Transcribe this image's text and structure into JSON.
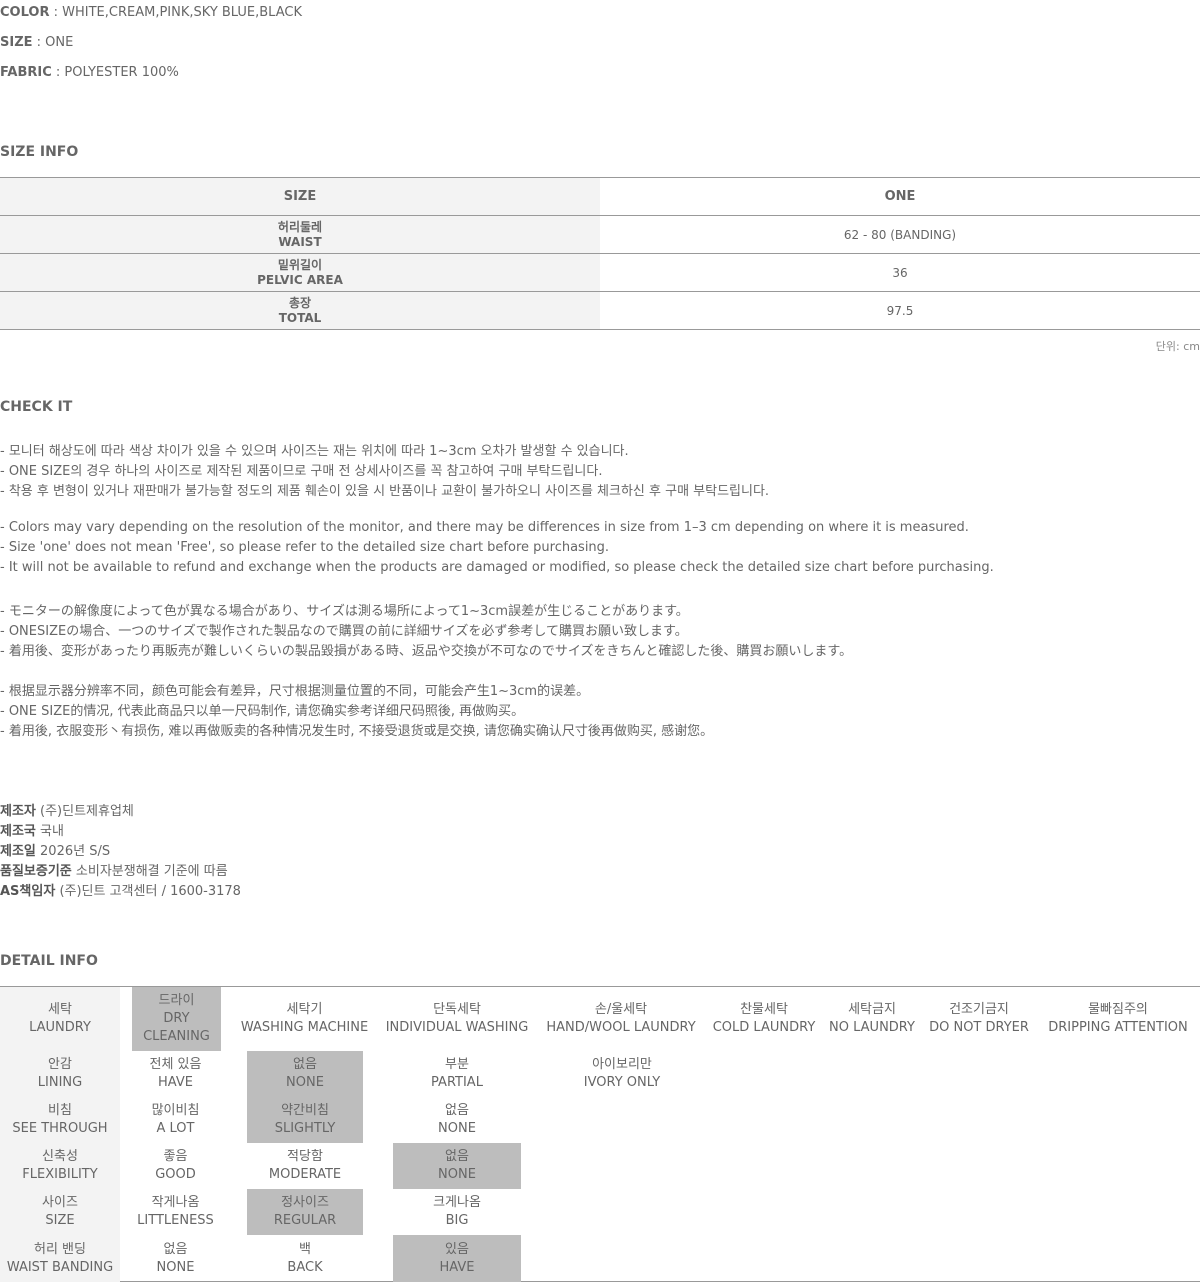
{
  "specs": [
    {
      "label": "COLOR",
      "value": " : WHITE,CREAM,PINK,SKY BLUE,BLACK"
    },
    {
      "label": "SIZE",
      "value": " : ONE"
    },
    {
      "label": "FABRIC",
      "value": " : POLYESTER 100%"
    }
  ],
  "size_info": {
    "title": "SIZE INFO",
    "header": {
      "label": "SIZE",
      "value": "ONE"
    },
    "rows": [
      {
        "ko": "허리둘레",
        "en": "WAIST",
        "value": "62 - 80 (BANDING)"
      },
      {
        "ko": "밑위길이",
        "en": "PELVIC AREA",
        "value": "36"
      },
      {
        "ko": "총장",
        "en": "TOTAL",
        "value": "97.5"
      }
    ],
    "unit": "단위: cm"
  },
  "check_it": {
    "title": "CHECK IT",
    "lines": [
      "- 모니터 해상도에 따라 색상 차이가 있을 수 있으며 사이즈는 재는 위치에 따라 1~3cm 오차가 발생할 수 있습니다.",
      "- ONE SIZE의 경우 하나의 사이즈로 제작된 제품이므로 구매 전 상세사이즈를 꼭 참고하여 구매 부탁드립니다.",
      "- 착용 후 변형이 있거나 재판매가 불가능할 정도의 제품 훼손이 있을 시 반품이나 교환이 불가하오니 사이즈를 체크하신 후 구매 부탁드립니다.",
      "- Colors may vary depending on the resolution of the monitor, and there may be differences in size from 1–3 cm depending on where it is measured.",
      "- Size 'one' does not mean 'Free', so please refer to the detailed size chart before purchasing.",
      "- It will not be available to refund and exchange when the products are damaged or modified, so please check the detailed size chart before purchasing.",
      "- モニターの解像度によって色が異なる場合があり、サイズは測る場所によって1~3cm誤差が生じることがあります。",
      "- ONESIZEの場合、一つのサイズで製作された製品なので購買の前に詳細サイズを必ず参考して購買お願い致します。",
      "- 着用後、変形があったり再販売が難しいくらいの製品毀損がある時、返品や交換が不可なのでサイズをきちんと確認した後、購買お願いします。",
      "- 根据显示器分辨率不同，颜色可能会有差异，尺寸根据测量位置的不同，可能会产生1~3cm的误差。",
      "- ONE SIZE的情况, 代表此商品只以单一尺码制作, 请您确实参考详细尺码照後, 再做购买。",
      "- 着用後, 衣服变形丶有损伤, 难以再做贩卖的各种情况发生时, 不接受退货或是交换, 请您确实确认尺寸後再做购买, 感谢您。"
    ]
  },
  "maker": [
    {
      "label": "제조자",
      "value": " (주)딘트제휴업체"
    },
    {
      "label": "제조국",
      "value": " 국내"
    },
    {
      "label": "제조일",
      "value": " 2026년 S/S"
    },
    {
      "label": "품질보증기준",
      "value": " 소비자분쟁해결 기준에 따름"
    },
    {
      "label": "AS책임자",
      "value": " (주)딘트 고객센터 / 1600-3178"
    }
  ],
  "detail_info": {
    "title": "DETAIL INFO",
    "laundry": {
      "label": [
        "세탁",
        "LAUNDRY"
      ],
      "options": [
        {
          "ko": "드라이",
          "en": "DRY",
          "en2": "CLEANING",
          "selected": true
        },
        {
          "ko": "세탁기",
          "en": "WASHING MACHINE",
          "selected": false
        },
        {
          "ko": "단독세탁",
          "en": "INDIVIDUAL WASHING",
          "selected": false
        },
        {
          "ko": "손/울세탁",
          "en": "HAND/WOOL LAUNDRY",
          "selected": false
        },
        {
          "ko": "찬물세탁",
          "en": "COLD LAUNDRY",
          "selected": false
        },
        {
          "ko": "세탁금지",
          "en": "NO LAUNDRY",
          "selected": false
        },
        {
          "ko": "건조기금지",
          "en": "DO NOT DRYER",
          "selected": false
        },
        {
          "ko": "물빠짐주의",
          "en": "DRIPPING ATTENTION",
          "selected": false
        }
      ]
    },
    "rows": [
      {
        "label": [
          "안감",
          "LINING"
        ],
        "options": [
          {
            "ko": "전체 있음",
            "en": "HAVE",
            "selected": false
          },
          {
            "ko": "없음",
            "en": "NONE",
            "selected": true
          },
          {
            "ko": "부분",
            "en": "PARTIAL",
            "selected": false
          },
          {
            "ko": "아이보리만",
            "en": "IVORY ONLY",
            "selected": false
          }
        ]
      },
      {
        "label": [
          "비침",
          "SEE THROUGH"
        ],
        "options": [
          {
            "ko": "많이비침",
            "en": "A LOT",
            "selected": false
          },
          {
            "ko": "약간비침",
            "en": "SLIGHTLY",
            "selected": true
          },
          {
            "ko": "없음",
            "en": "NONE",
            "selected": false
          }
        ]
      },
      {
        "label": [
          "신축성",
          "FLEXIBILITY"
        ],
        "options": [
          {
            "ko": "좋음",
            "en": "GOOD",
            "selected": false
          },
          {
            "ko": "적당함",
            "en": "MODERATE",
            "selected": false
          },
          {
            "ko": "없음",
            "en": "NONE",
            "selected": true
          }
        ]
      },
      {
        "label": [
          "사이즈",
          "SIZE"
        ],
        "options": [
          {
            "ko": "작게나옴",
            "en": "LITTLENESS",
            "selected": false
          },
          {
            "ko": "정사이즈",
            "en": "REGULAR",
            "selected": true
          },
          {
            "ko": "크게나옴",
            "en": "BIG",
            "selected": false
          }
        ]
      },
      {
        "label": [
          "허리 밴딩",
          "WAIST BANDING"
        ],
        "options": [
          {
            "ko": "없음",
            "en": "NONE",
            "selected": false
          },
          {
            "ko": "백",
            "en": "BACK",
            "selected": false
          },
          {
            "ko": "있음",
            "en": "HAVE",
            "selected": true
          }
        ]
      }
    ]
  }
}
